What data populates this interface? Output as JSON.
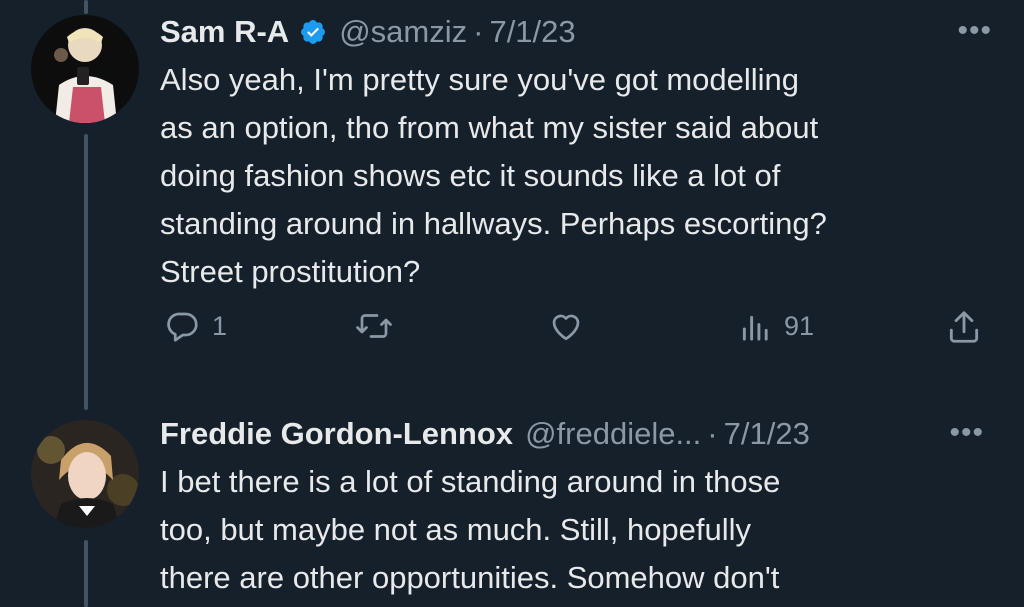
{
  "tweets": [
    {
      "name": "Sam R-A",
      "verified": true,
      "handle": "@samziz",
      "separator": "·",
      "date": "7/1/23",
      "more": "•••",
      "lines": [
        "Also yeah, I'm pretty sure you've got modelling",
        "as an option, tho from what my sister said about",
        "doing fashion shows etc it sounds like a lot of",
        "standing around in hallways. Perhaps escorting?",
        "Street prostitution?"
      ],
      "replies": "1",
      "views": "91"
    },
    {
      "name": "Freddie Gordon-Lennox",
      "handle": "@freddiele...",
      "separator": "·",
      "date": "7/1/23",
      "more": "•••",
      "lines": [
        "I bet there is a lot of standing around in those",
        "too, but maybe not as much. Still, hopefully",
        "there are other opportunities. Somehow don't"
      ]
    }
  ],
  "icons": {
    "verified": "verified-badge-icon",
    "reply": "reply-icon",
    "retweet": "retweet-icon",
    "like": "like-icon",
    "views": "views-icon",
    "share": "share-icon",
    "more": "more-icon"
  },
  "colors": {
    "background": "#15202b",
    "text": "#e7e9ea",
    "secondary": "#8b98a5",
    "verified": "#1d9bf0",
    "thread_line": "#425364"
  }
}
